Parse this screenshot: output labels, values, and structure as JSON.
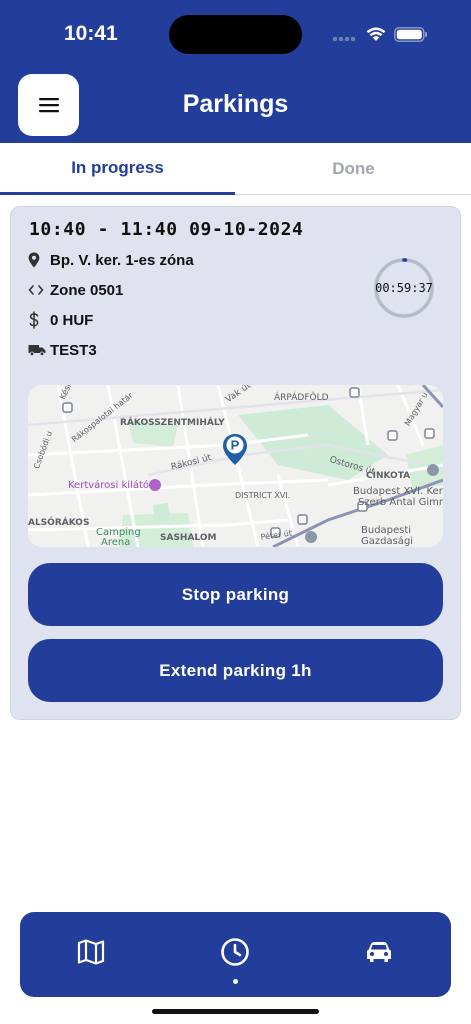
{
  "status_bar": {
    "time": "10:41"
  },
  "header": {
    "title": "Parkings"
  },
  "tabs": [
    {
      "label": "In progress",
      "active": true
    },
    {
      "label": "Done",
      "active": false
    }
  ],
  "parking": {
    "time_range": "10:40 - 11:40 09-10-2024",
    "location": "Bp. V. ker. 1-es zóna",
    "zone": "Zone 0501",
    "price": "0 HUF",
    "vehicle": "TEST3",
    "countdown": "00:59:37",
    "map_labels": {
      "kesmark": "Késmárk u",
      "rakospalotai": "Rákospalotai határ",
      "vak": "Vak út",
      "arpadfold": "ÁRPÁDFÖLD",
      "magyar": "Magyar u",
      "rakosszentmihaly": "RÁKOSSZENTMIHÁLY",
      "rakosi": "Rákosi út",
      "ostoros": "Ostoros út",
      "csobodi": "Csobódi u",
      "cinkota": "CINKOTA",
      "kertvarosi": "Kertvárosi kilátó",
      "district": "DISTRICT XVI.",
      "budapest_xvi": "Budapest XVI. Kerül",
      "szerb": "Szerb Antal Gimnáziu",
      "alsorakos": "ALSÓRÁKOS",
      "camping": "Camping",
      "arena": "Arena",
      "sashalom": "SASHALOM",
      "peter": "Péter út",
      "budapesti": "Budapesti",
      "gazdasagi": "Gazdasági"
    },
    "stop_label": "Stop parking",
    "extend_label": "Extend parking 1h"
  },
  "colors": {
    "primary": "#233D9A",
    "card": "#DFE3EF",
    "inactive_tab": "#A2A6AE",
    "map_pin": "#1E5FA8"
  },
  "icons": {
    "menu": "hamburger-icon",
    "location": "location-pin-icon",
    "zone": "code-brackets-icon",
    "price": "dollar-icon",
    "vehicle": "truck-icon",
    "nav_map": "map-icon",
    "nav_history": "clock-icon",
    "nav_car": "car-icon"
  }
}
